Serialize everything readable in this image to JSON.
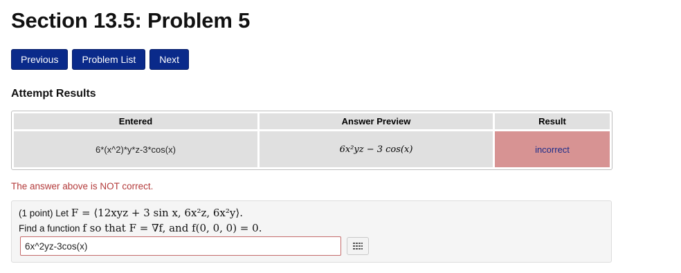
{
  "page": {
    "title": "Section 13.5: Problem 5",
    "nav": {
      "previous": "Previous",
      "problem_list": "Problem List",
      "next": "Next"
    }
  },
  "attempt_results": {
    "heading": "Attempt Results",
    "columns": [
      "Entered",
      "Answer Preview",
      "Result"
    ],
    "row": {
      "entered": "6*(x^2)*y*z-3*cos(x)",
      "preview": "6x²yz − 3 cos(x)",
      "result": "incorrect"
    },
    "feedback": "The answer above is NOT correct."
  },
  "problem": {
    "points": "(1 point) Let",
    "field_expr": "F = ⟨12xyz + 3 sin x, 6x²z, 6x²y⟩.",
    "prompt_text": "Find a function",
    "prompt_math": "f so that F = ∇f, and f(0, 0, 0) = 0.",
    "answer_value": "6x^2yz-3cos(x)",
    "keypad_icon": "keypad-icon"
  },
  "colors": {
    "nav_button": "#0a2a8a",
    "incorrect_bg": "#d79393",
    "feedback_text": "#b33a3a"
  }
}
